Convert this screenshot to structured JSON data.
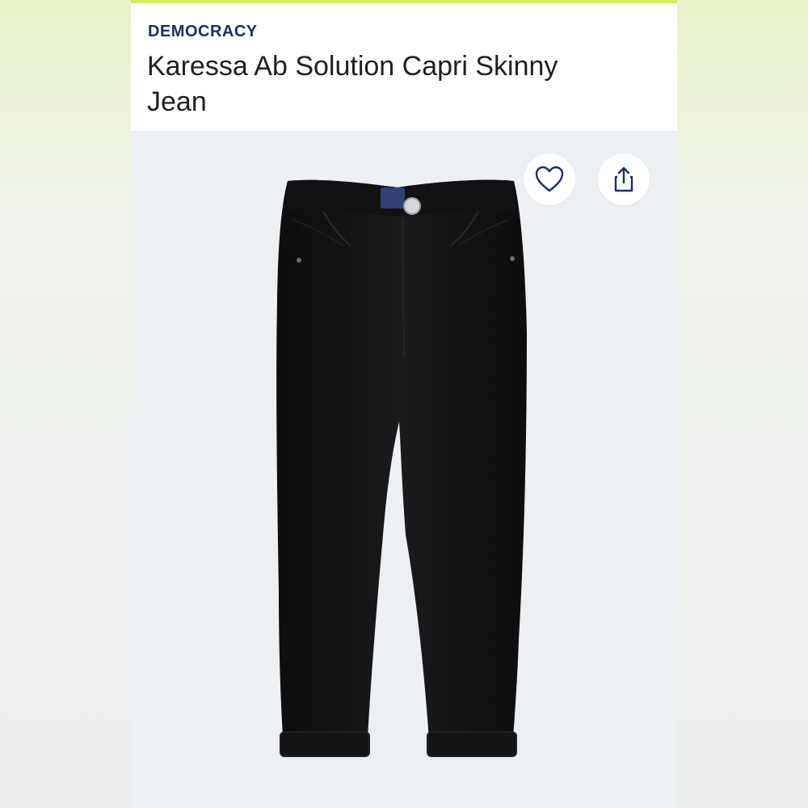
{
  "product": {
    "brand": "DEMOCRACY",
    "title": "Karessa Ab Solution Capri Skinny Jean"
  },
  "actions": {
    "favorite_icon": "heart-outline-icon",
    "share_icon": "share-upload-icon"
  },
  "colors": {
    "brand_text": "#1d2c6e",
    "accent": "#d8ec5a",
    "image_background": "#edf0f2",
    "product_color": "#111111"
  }
}
